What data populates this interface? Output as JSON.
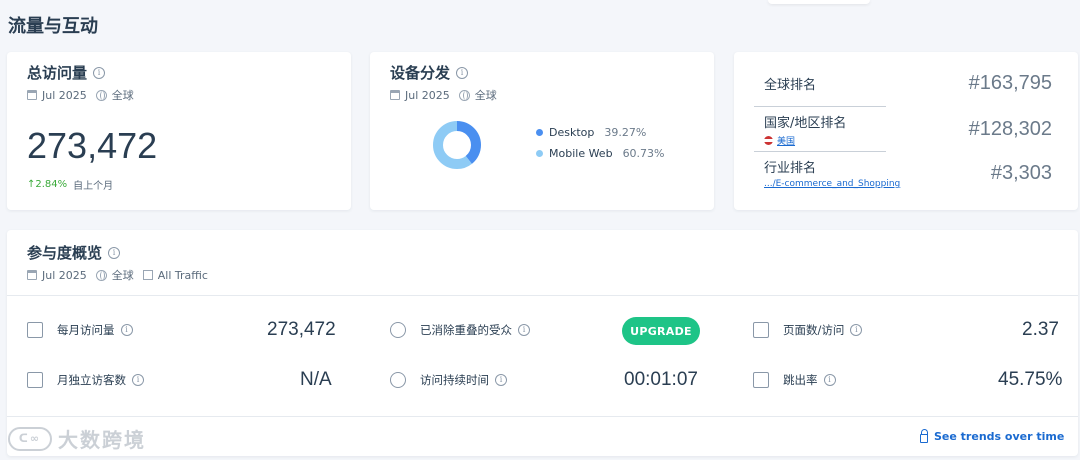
{
  "section_title": "流量与互动",
  "visits_card": {
    "title": "总访问量",
    "date": "Jul 2025",
    "region": "全球",
    "value": "273,472",
    "change": "↑2.84%",
    "change_note": "自上个月"
  },
  "device_card": {
    "title": "设备分发",
    "date": "Jul 2025",
    "region": "全球",
    "legend": [
      {
        "label": "Desktop",
        "pct": "39.27%",
        "color": "#4a8ff0"
      },
      {
        "label": "Mobile Web",
        "pct": "60.73%",
        "color": "#8ecbf5"
      }
    ],
    "chart_data": {
      "type": "pie",
      "categories": [
        "Desktop",
        "Mobile Web"
      ],
      "values": [
        39.27,
        60.73
      ],
      "colors": [
        "#4a8ff0",
        "#8ecbf5"
      ]
    }
  },
  "rank_card": {
    "global": {
      "label": "全球排名",
      "value": "#163,795"
    },
    "country": {
      "label": "国家/地区排名",
      "sub": "美国",
      "value": "#128,302"
    },
    "category": {
      "label": "行业排名",
      "sub": ".../E-commerce_and_Shopping",
      "value": "#3,303"
    }
  },
  "engagement": {
    "title": "参与度概览",
    "date": "Jul 2025",
    "region": "全球",
    "traffic": "All Traffic",
    "metrics": {
      "monthly_visits": {
        "label": "每月访问量",
        "value": "273,472",
        "icon": "calendar-icon"
      },
      "dedup_audience": {
        "label": "已消除重叠的受众",
        "value": "UPGRADE",
        "icon": "users-icon"
      },
      "pages_per_visit": {
        "label": "页面数/访问",
        "value": "2.37",
        "icon": "pages-icon"
      },
      "unique_visitors": {
        "label": "月独立访客数",
        "value": "N/A",
        "icon": "visitor-icon"
      },
      "visit_duration": {
        "label": "访问持续时间",
        "value": "00:01:07",
        "icon": "stopwatch-icon"
      },
      "bounce_rate": {
        "label": "跳出率",
        "value": "45.75%",
        "icon": "bounce-icon"
      }
    },
    "trends_link": "See trends over time"
  },
  "watermark": {
    "logo": "ᑕ∞",
    "text": "大数跨境"
  }
}
